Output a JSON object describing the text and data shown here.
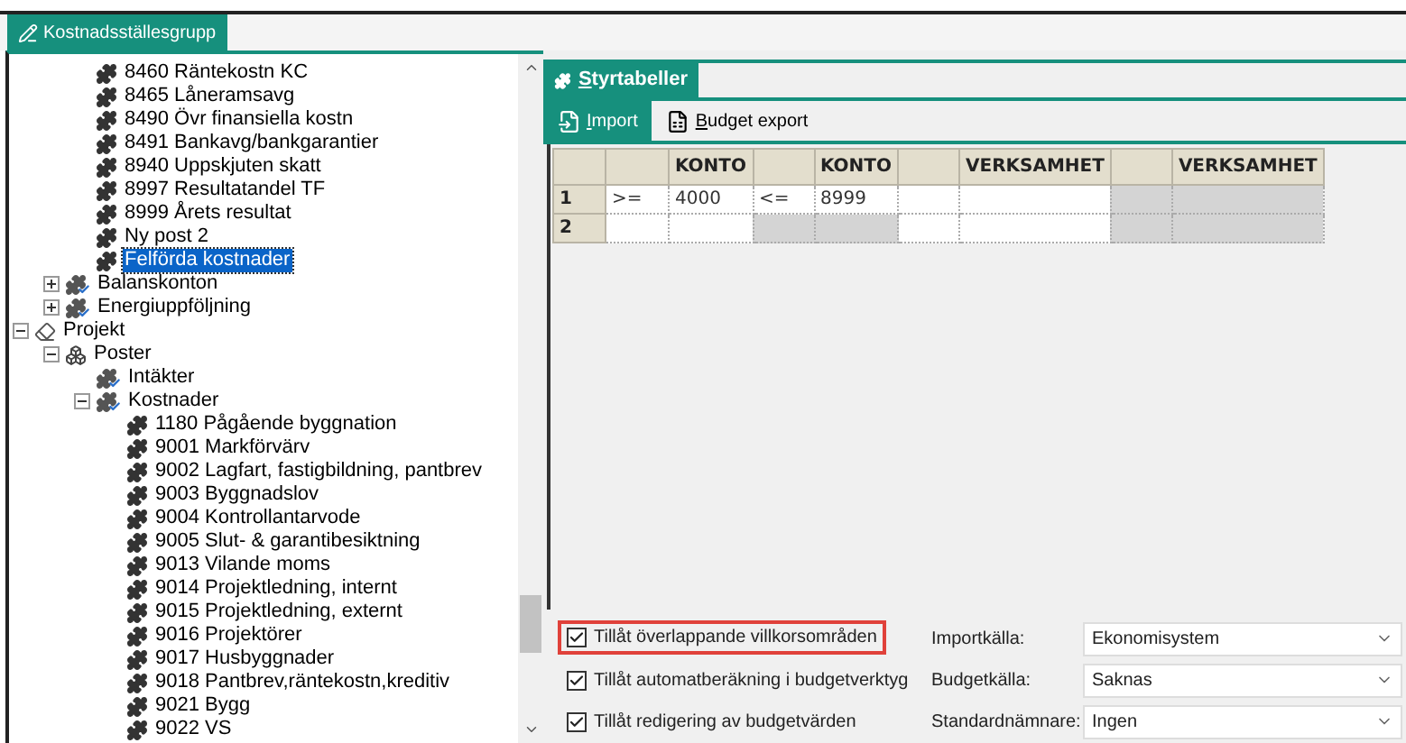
{
  "window_tab": {
    "label": "Kostnadsställesgrupp",
    "selected": true
  },
  "tree": [
    {
      "children": [
        {
          "children": [
            {
              "label": "8460 Räntekostn KC",
              "kind": "leaf",
              "selected": false
            },
            {
              "label": "8465 Låneramsavg",
              "kind": "leaf",
              "selected": false
            },
            {
              "label": "8490 Övr finansiella kostn",
              "kind": "leaf",
              "selected": false
            },
            {
              "label": "8491 Bankavg/bankgarantier",
              "kind": "leaf",
              "selected": false
            },
            {
              "label": "8940 Uppskjuten skatt",
              "kind": "leaf",
              "selected": false
            },
            {
              "label": "8997 Resultatandel TF",
              "kind": "leaf",
              "selected": false
            },
            {
              "label": "8999 Årets resultat",
              "kind": "leaf",
              "selected": false
            },
            {
              "label": "Ny post 2",
              "kind": "leaf",
              "selected": false
            },
            {
              "label": "Felförda kostnader",
              "kind": "leaf",
              "selected": true
            }
          ]
        },
        {
          "label": "Balanskonton",
          "kind": "group",
          "expanded": false,
          "selected": false
        },
        {
          "label": "Energiuppföljning",
          "kind": "group",
          "expanded": false,
          "selected": false
        }
      ]
    },
    {
      "label": "Projekt",
      "kind": "project",
      "expanded": true,
      "selected": false,
      "children": [
        {
          "label": "Poster",
          "kind": "poster",
          "expanded": true,
          "selected": false,
          "children": [
            {
              "label": "Intäkter",
              "kind": "group",
              "selected": false
            },
            {
              "label": "Kostnader",
              "kind": "group",
              "expanded": true,
              "selected": false,
              "children": [
                {
                  "label": "1180 Pågående byggnation",
                  "kind": "leaf",
                  "selected": false
                },
                {
                  "label": "9001 Markförvärv",
                  "kind": "leaf",
                  "selected": false
                },
                {
                  "label": "9002 Lagfart, fastigbildning, pantbrev",
                  "kind": "leaf",
                  "selected": false
                },
                {
                  "label": "9003 Byggnadslov",
                  "kind": "leaf",
                  "selected": false
                },
                {
                  "label": "9004 Kontrollantarvode",
                  "kind": "leaf",
                  "selected": false
                },
                {
                  "label": "9005 Slut- & garantibesiktning",
                  "kind": "leaf",
                  "selected": false
                },
                {
                  "label": "9013 Vilande moms",
                  "kind": "leaf",
                  "selected": false
                },
                {
                  "label": "9014 Projektledning, internt",
                  "kind": "leaf",
                  "selected": false
                },
                {
                  "label": "9015 Projektledning, externt",
                  "kind": "leaf",
                  "selected": false
                },
                {
                  "label": "9016 Projektörer",
                  "kind": "leaf",
                  "selected": false
                },
                {
                  "label": "9017 Husbyggnader",
                  "kind": "leaf",
                  "selected": false
                },
                {
                  "label": "9018 Pantbrev,räntekostn,kreditiv",
                  "kind": "leaf",
                  "selected": false
                },
                {
                  "label": "9021 Bygg",
                  "kind": "leaf",
                  "selected": false
                },
                {
                  "label": "9022 VS",
                  "kind": "leaf",
                  "selected": false
                }
              ]
            }
          ]
        }
      ]
    }
  ],
  "panel_tab": {
    "label": "Styrtabeller",
    "selected": true
  },
  "toolbar": [
    {
      "label": "Import",
      "kind": "import",
      "selected": true
    },
    {
      "label": "Budget export",
      "kind": "export",
      "selected": false
    }
  ],
  "table": {
    "columns": [
      {},
      {
        "label": "KONTO"
      },
      {},
      {
        "label": "KONTO"
      },
      {},
      {
        "label": "VERKSAMHET"
      },
      {},
      {
        "label": "VERKSAMHET"
      }
    ],
    "rows": [
      {
        "number": "1",
        "cells": [
          {
            "text": ">=",
            "disabled": false
          },
          {
            "text": "4000",
            "disabled": false
          },
          {
            "text": "<=",
            "disabled": false
          },
          {
            "text": "8999",
            "disabled": false
          },
          {
            "disabled": false
          },
          {
            "disabled": false
          },
          {
            "disabled": true
          },
          {
            "disabled": true
          }
        ]
      },
      {
        "number": "2",
        "cells": [
          {
            "disabled": false
          },
          {
            "disabled": false
          },
          {
            "disabled": true
          },
          {
            "disabled": true
          },
          {
            "disabled": false
          },
          {
            "disabled": false
          },
          {
            "disabled": true
          },
          {
            "disabled": true
          }
        ]
      }
    ]
  },
  "options": [
    {
      "label": "Tillåt överlappande villkorsområden",
      "checked": true,
      "highlighted": true
    },
    {
      "label": "Tillåt automatberäkning i budgetverktyg",
      "checked": true,
      "highlighted": false
    },
    {
      "label": "Tillåt redigering av budgetvärden",
      "checked": true,
      "highlighted": false
    }
  ],
  "selects": [
    {
      "label": "Importkälla:",
      "value": "Ekonomisystem"
    },
    {
      "label": "Budgetkälla:",
      "value": "Saknas"
    },
    {
      "label": "Standardnämnare:",
      "value": "Ingen"
    }
  ]
}
